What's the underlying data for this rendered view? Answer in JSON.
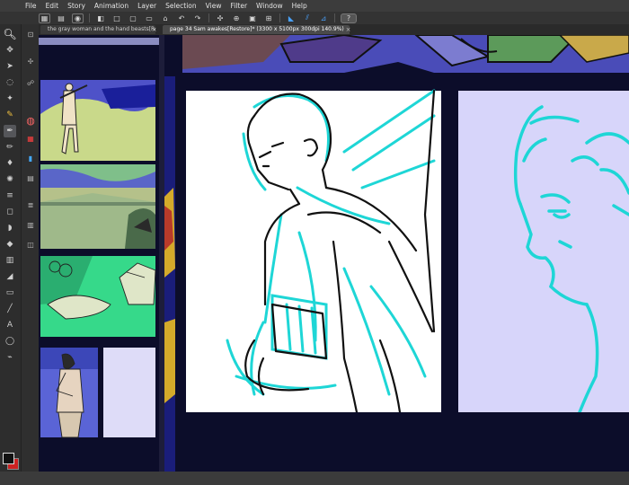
{
  "menu": [
    "File",
    "Edit",
    "Story",
    "Animation",
    "Layer",
    "Selection",
    "View",
    "Filter",
    "Window",
    "Help"
  ],
  "toolbar_icons": [
    "grid-icon",
    "layout-icon",
    "eye-icon",
    "layers-icon",
    "square-icon",
    "new-icon",
    "open-icon",
    "save-icon",
    "undo-icon",
    "redo-icon",
    "transform-icon",
    "target-icon",
    "fill-icon",
    "snap-icon",
    "snap-to-ruler-icon",
    "symmetry-icon",
    "help-icon"
  ],
  "tabs": [
    {
      "label": "the gray woman and the hand beasts[Re"
    },
    {
      "label": "page 34 Sam awakes[Restore]* (3300 x 5100px 300dpi 140.9%)"
    }
  ],
  "tools": [
    "zoom-icon",
    "move-icon",
    "operation-icon",
    "lasso-icon",
    "magic-wand-icon",
    "eyedropper-icon",
    "pen-icon",
    "pencil-icon",
    "brush-icon",
    "airbrush-icon",
    "decoration-icon",
    "eraser-icon",
    "blend-icon",
    "fill-icon",
    "gradient-icon",
    "figure-icon",
    "frame-border-icon",
    "ruler-icon",
    "text-icon",
    "balloon-icon",
    "correct-line-icon"
  ],
  "colors": {
    "main": "#111111",
    "sub": "#cc2222",
    "accent": "#00cccc",
    "canvas_bg": "#0c0d2a"
  }
}
